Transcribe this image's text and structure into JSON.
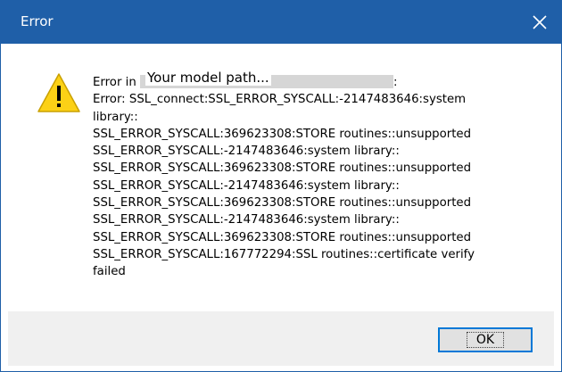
{
  "window": {
    "title": "Error",
    "close_icon": "close-icon"
  },
  "dialog": {
    "icon": "warning-icon",
    "redaction_label": "Your model path...",
    "message_lines": [
      {
        "prefix": "Error in ",
        "suffix": ":"
      },
      "Error: SSL_connect:SSL_ERROR_SYSCALL:-2147483646:system",
      "library::",
      "SSL_ERROR_SYSCALL:369623308:STORE routines::unsupported",
      "SSL_ERROR_SYSCALL:-2147483646:system library::",
      "SSL_ERROR_SYSCALL:369623308:STORE routines::unsupported",
      "SSL_ERROR_SYSCALL:-2147483646:system library::",
      "SSL_ERROR_SYSCALL:369623308:STORE routines::unsupported",
      "SSL_ERROR_SYSCALL:-2147483646:system library::",
      "SSL_ERROR_SYSCALL:369623308:STORE routines::unsupported",
      "SSL_ERROR_SYSCALL:167772294:SSL routines::certificate verify",
      "failed"
    ]
  },
  "buttons": {
    "ok_label": "OK"
  },
  "colors": {
    "titlebar": "#1f5fa8",
    "button_border": "#0078d7",
    "button_bar": "#f0f0f0",
    "warning_fill": "#fcd116"
  }
}
